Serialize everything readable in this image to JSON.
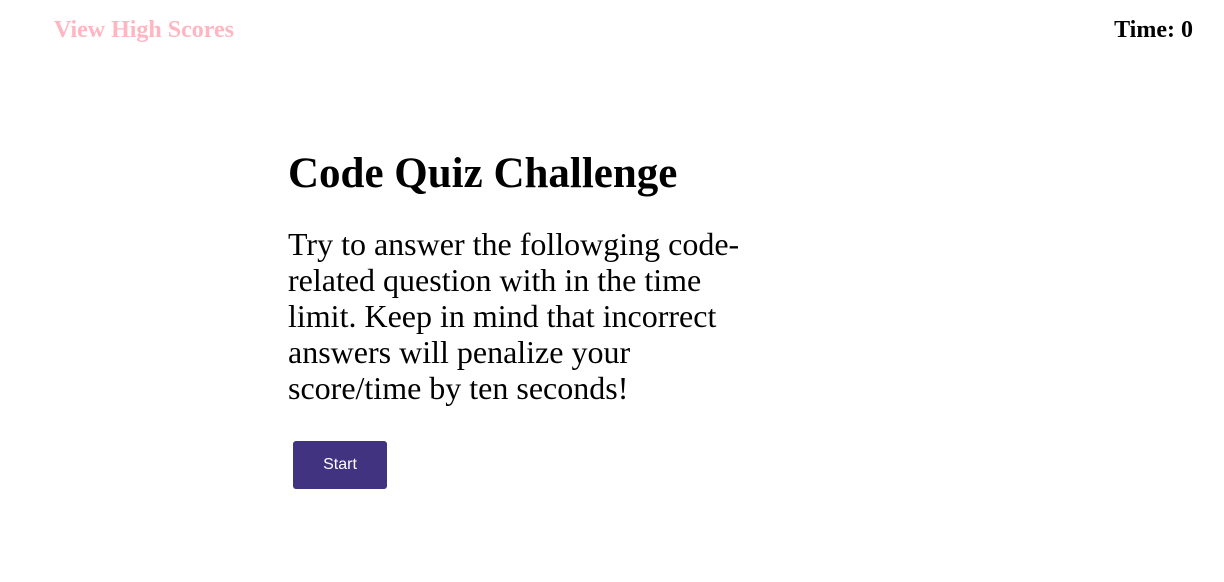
{
  "header": {
    "high_scores_label": "View High Scores",
    "timer_label": "Time: 0"
  },
  "quiz": {
    "title": "Code Quiz Challenge",
    "description": "Try to answer the followging code-related question with in the time limit. Keep in mind that incorrect answers will penalize your score/time by ten seconds!",
    "start_label": "Start"
  },
  "colors": {
    "link": "#ffb6c1",
    "button_bg": "#41337f",
    "button_text": "#ffffff"
  }
}
